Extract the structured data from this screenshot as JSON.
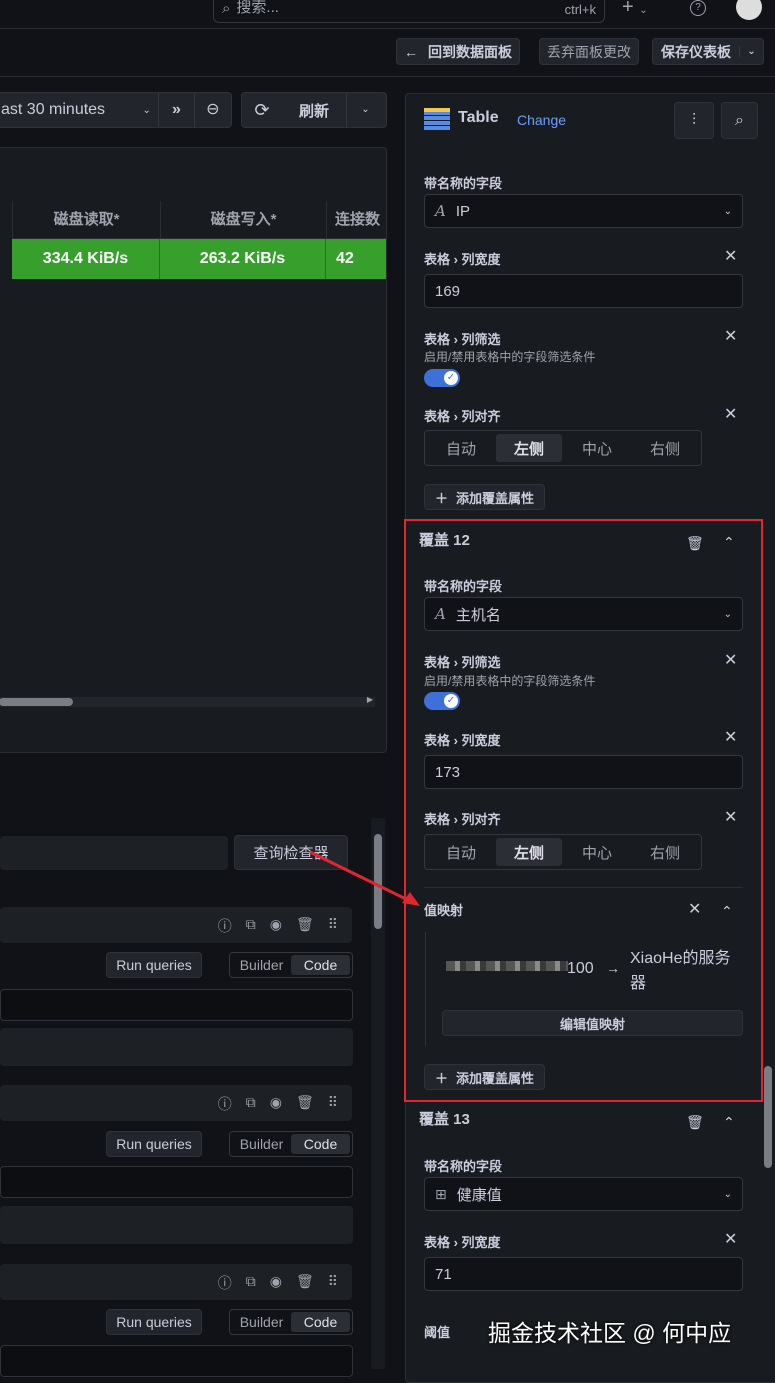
{
  "topbar": {
    "search_placeholder": "搜索...",
    "shortcut": "ctrl+k",
    "plus": "+",
    "help": "?"
  },
  "toolbar": {
    "back": "回到数据面板",
    "discard": "丢弃面板更改",
    "save": "保存仪表板"
  },
  "time": {
    "range": "ast 30 minutes",
    "refresh": "刷新"
  },
  "table": {
    "headers": [
      "磁盘读取*",
      "磁盘写入*",
      "连接数"
    ],
    "row": [
      "334.4 KiB/s",
      "263.2 KiB/s",
      "42"
    ],
    "cell_color": "#37a02d"
  },
  "query": {
    "inspector": "查询检查器",
    "rows": [
      {
        "run": "Run queries",
        "builder": "Builder",
        "code": "Code"
      },
      {
        "run": "Run queries",
        "builder": "Builder",
        "code": "Code"
      },
      {
        "run": "Run queries",
        "builder": "Builder",
        "code": "Code"
      }
    ]
  },
  "options": {
    "viz_name": "Table",
    "change": "Change",
    "o11": {
      "field_label": "带名称的字段",
      "field_value": "IP",
      "width_label": "表格 › 列宽度",
      "width_value": "169",
      "filter_label": "表格 › 列筛选",
      "filter_desc": "启用/禁用表格中的字段筛选条件",
      "align_label": "表格 › 列对齐",
      "align": [
        "自动",
        "左侧",
        "中心",
        "右侧"
      ],
      "add": "添加覆盖属性"
    },
    "o12": {
      "title": "覆盖 12",
      "field_label": "带名称的字段",
      "field_value": "主机名",
      "filter_label": "表格 › 列筛选",
      "filter_desc": "启用/禁用表格中的字段筛选条件",
      "width_label": "表格 › 列宽度",
      "width_value": "173",
      "align_label": "表格 › 列对齐",
      "align": [
        "自动",
        "左侧",
        "中心",
        "右侧"
      ],
      "mapping_label": "值映射",
      "mapping_from": "100",
      "mapping_to": "XiaoHe的服务器",
      "edit_mapping": "编辑值映射",
      "add": "添加覆盖属性"
    },
    "o13": {
      "title": "覆盖 13",
      "field_label": "带名称的字段",
      "field_value": "健康值",
      "width_label": "表格 › 列宽度",
      "width_value": "71",
      "threshold_label": "阈值"
    }
  },
  "watermark": "掘金技术社区 @ 何中应",
  "highlight_color": "#e0262f"
}
